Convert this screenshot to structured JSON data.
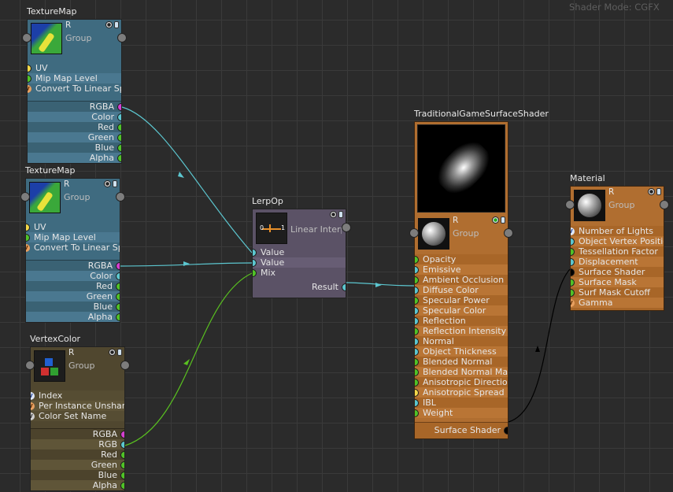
{
  "shader_mode": "Shader Mode: CGFX",
  "texmap1": {
    "title": "TextureMap",
    "r": "R",
    "group": "Group",
    "inputs": [
      "UV",
      "Mip Map Level",
      "Convert To Linear Space"
    ],
    "outputs": [
      "RGBA",
      "Color",
      "Red",
      "Green",
      "Blue",
      "Alpha"
    ]
  },
  "texmap2": {
    "title": "TextureMap",
    "r": "R",
    "group": "Group",
    "inputs": [
      "UV",
      "Mip Map Level",
      "Convert To Linear Space"
    ],
    "outputs": [
      "RGBA",
      "Color",
      "Red",
      "Green",
      "Blue",
      "Alpha"
    ]
  },
  "vertexcolor": {
    "title": "VertexColor",
    "r": "R",
    "group": "Group",
    "inputs": [
      "Index",
      "Per Instance Unshared",
      "Color Set Name"
    ],
    "outputs": [
      "RGBA",
      "RGB",
      "Red",
      "Green",
      "Blue",
      "Alpha"
    ]
  },
  "lerp": {
    "title": "LerpOp",
    "head_label": "Linear Interpolation",
    "inputs": [
      "Value",
      "Value",
      "Mix"
    ],
    "output": "Result"
  },
  "surface": {
    "title": "TraditionalGameSurfaceShader",
    "r": "R",
    "group": "Group",
    "inputs": [
      "Opacity",
      "Emissive",
      "Ambient Occlusion",
      "Diffuse Color",
      "Specular Power",
      "Specular Color",
      "Reflection",
      "Reflection Intensity",
      "Normal",
      "Object Thickness",
      "Blended Normal",
      "Blended Normal Mask",
      "Anisotropic Direction",
      "Anisotropic Spread",
      "IBL",
      "Weight"
    ],
    "output": "Surface Shader"
  },
  "material": {
    "title": "Material",
    "r": "R",
    "group": "Group",
    "inputs": [
      "Number of Lights",
      "Object Vertex Position",
      "Tessellation Factor",
      "Displacement",
      "Surface Shader",
      "Surface Mask",
      "Surf Mask Cutoff",
      "Gamma"
    ]
  },
  "colors": {
    "teal_body": "#3f6b80",
    "olive_body": "#50472f",
    "lerp_body": "#5b5266",
    "orange_body": "#b06e30",
    "wire_color": "#5cc6cf",
    "wire_float": "#59c020",
    "wire_shader": "#000000"
  },
  "icons": {
    "texture": "texture-map-icon",
    "vertex": "vertex-color-icon",
    "lerp": "lerp-icon",
    "sphere": "material-sphere-icon"
  }
}
